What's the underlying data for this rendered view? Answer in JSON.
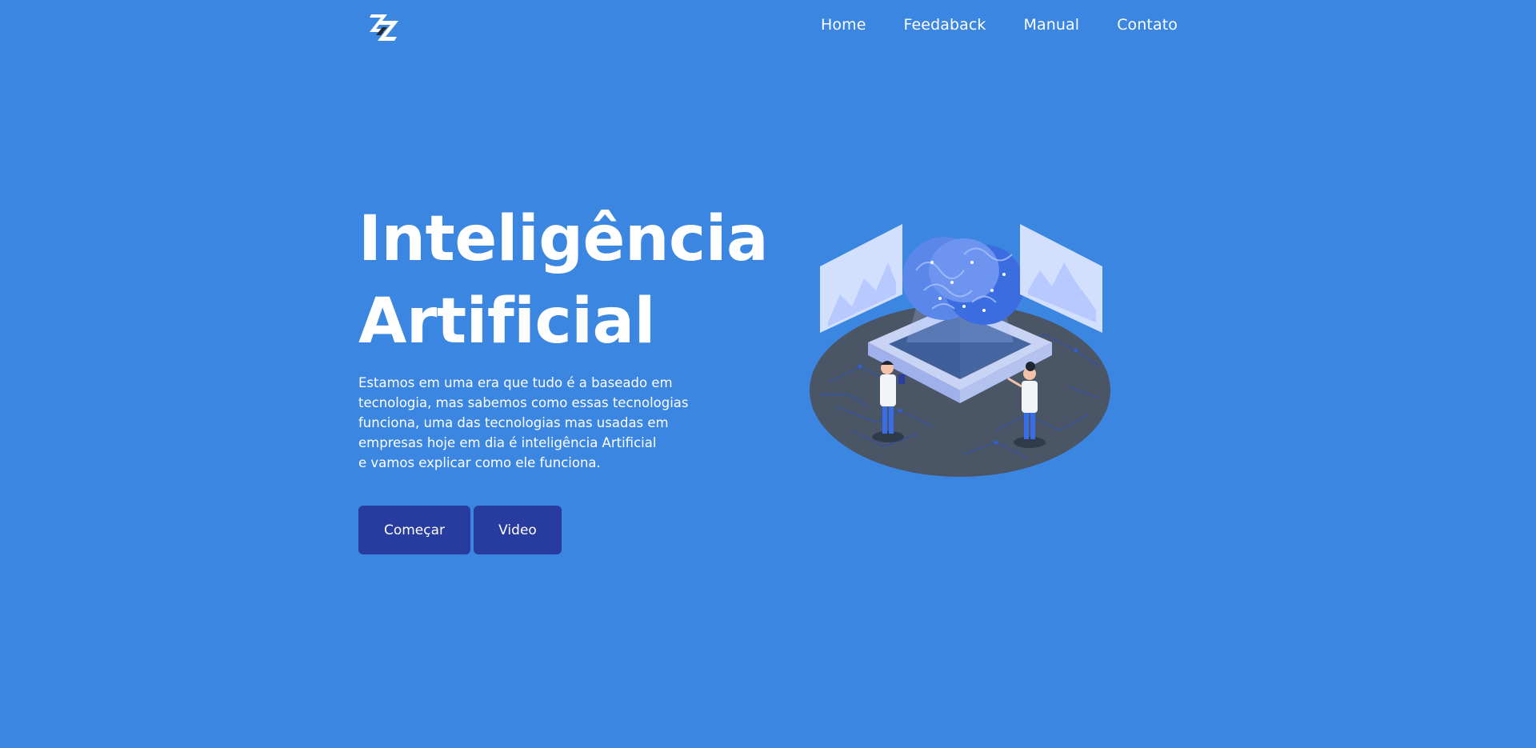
{
  "brand": {
    "logo_icon": "zz-logo-icon"
  },
  "nav": {
    "items": [
      {
        "label": "Home"
      },
      {
        "label": "Feedaback"
      },
      {
        "label": "Manual"
      },
      {
        "label": "Contato"
      }
    ]
  },
  "hero": {
    "title_lines": [
      "Inteligência",
      "Artificial"
    ],
    "description_lines": [
      "Estamos em uma era que tudo é a baseado em",
      "tecnologia, mas sabemos como essas tecnologias",
      "funciona, uma das tecnologias mas usadas em",
      "empresas hoje em dia é inteligência Artificial",
      "e vamos explicar como ele funciona."
    ],
    "buttons": {
      "start_label": "Começar",
      "video_label": "Video"
    },
    "illustration_icon": "ai-brain-chip-illustration"
  },
  "colors": {
    "background": "#3a86e0",
    "button": "#283b9e",
    "text": "#ffffff"
  }
}
